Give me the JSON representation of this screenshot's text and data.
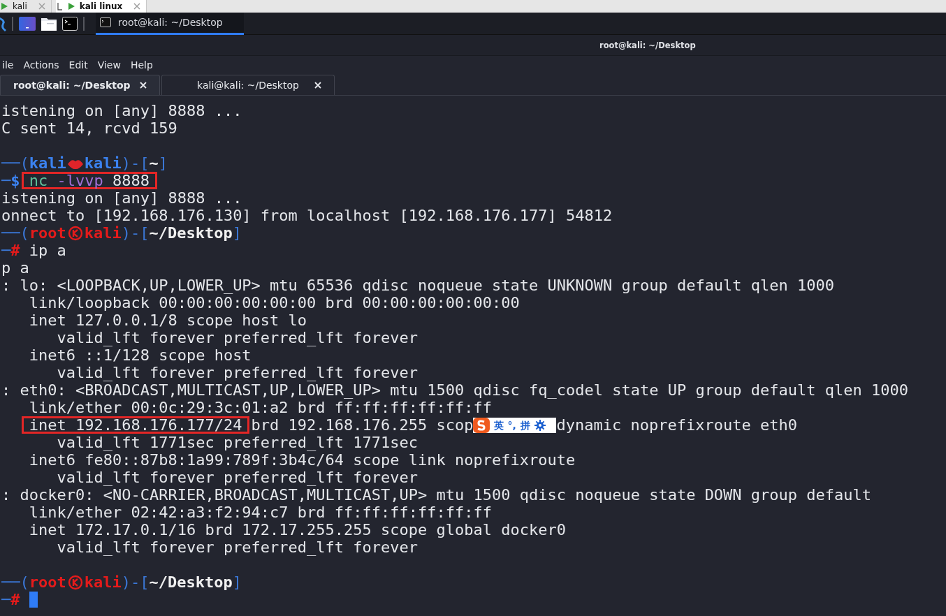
{
  "browser_tabs": [
    {
      "label": "kali",
      "selected": false
    },
    {
      "label": "kali linux",
      "selected": true
    }
  ],
  "panel": {
    "taskbar_items": [
      {
        "label": "root@kali: ~/Desktop",
        "selected": true
      }
    ]
  },
  "window": {
    "title": "root@kali: ~/Desktop",
    "menu": [
      "ile",
      "Actions",
      "Edit",
      "View",
      "Help"
    ],
    "tabs": [
      {
        "label": "root@kali: ~/Desktop",
        "selected": true
      },
      {
        "label": "kali@kali: ~/Desktop",
        "selected": false
      }
    ]
  },
  "terminal": {
    "lines": [
      {
        "kind": "text",
        "segments": [
          {
            "kind": "output",
            "text": "istening on [any] 8888 ..."
          }
        ]
      },
      {
        "kind": "text",
        "segments": [
          {
            "kind": "output",
            "text": "C sent 14, rcvd 159"
          }
        ]
      },
      {
        "kind": "blank"
      },
      {
        "kind": "text",
        "segments": [
          {
            "kind": "frame",
            "text": "──("
          },
          {
            "kind": "user",
            "text": "kali"
          },
          {
            "kind": "kiss-mark"
          },
          {
            "kind": "user",
            "text": "kali"
          },
          {
            "kind": "frame",
            "text": ")-["
          },
          {
            "kind": "path",
            "text": "~"
          },
          {
            "kind": "frame",
            "text": "]"
          }
        ]
      },
      {
        "kind": "text",
        "segments": [
          {
            "kind": "frame",
            "text": "─"
          },
          {
            "kind": "dollar",
            "text": "$ "
          },
          {
            "kind": "boxed",
            "segments": [
              {
                "kind": "command",
                "text": "nc"
              },
              {
                "kind": "option",
                "text": " -lvvp"
              },
              {
                "kind": "output",
                "text": " 8888"
              }
            ]
          }
        ]
      },
      {
        "kind": "text",
        "segments": [
          {
            "kind": "output",
            "text": "istening on [any] 8888 ..."
          }
        ]
      },
      {
        "kind": "text",
        "segments": [
          {
            "kind": "output",
            "text": "onnect to [192.168.176.130] from localhost [192.168.176.177] 54812"
          }
        ]
      },
      {
        "kind": "text",
        "segments": [
          {
            "kind": "frame",
            "text": "──("
          },
          {
            "kind": "root-user",
            "text": "root"
          },
          {
            "kind": "root-mark"
          },
          {
            "kind": "root-user",
            "text": "kali"
          },
          {
            "kind": "frame",
            "text": ")-["
          },
          {
            "kind": "path",
            "text": "~/Desktop"
          },
          {
            "kind": "frame",
            "text": "]"
          }
        ]
      },
      {
        "kind": "text",
        "segments": [
          {
            "kind": "frame",
            "text": "─"
          },
          {
            "kind": "hash",
            "text": "#"
          },
          {
            "kind": "output",
            "text": " ip a"
          }
        ]
      },
      {
        "kind": "text",
        "segments": [
          {
            "kind": "output",
            "text": "p a"
          }
        ]
      },
      {
        "kind": "text",
        "segments": [
          {
            "kind": "output",
            "text": ": lo: <LOOPBACK,UP,LOWER_UP> mtu 65536 qdisc noqueue state UNKNOWN group default qlen 1000"
          }
        ]
      },
      {
        "kind": "text",
        "segments": [
          {
            "kind": "output",
            "text": "   link/loopback 00:00:00:00:00:00 brd 00:00:00:00:00:00"
          }
        ]
      },
      {
        "kind": "text",
        "segments": [
          {
            "kind": "output",
            "text": "   inet 127.0.0.1/8 scope host lo"
          }
        ]
      },
      {
        "kind": "text",
        "segments": [
          {
            "kind": "output",
            "text": "      valid_lft forever preferred_lft forever"
          }
        ]
      },
      {
        "kind": "text",
        "segments": [
          {
            "kind": "output",
            "text": "   inet6 ::1/128 scope host"
          }
        ]
      },
      {
        "kind": "text",
        "segments": [
          {
            "kind": "output",
            "text": "      valid_lft forever preferred_lft forever"
          }
        ]
      },
      {
        "kind": "text",
        "segments": [
          {
            "kind": "output",
            "text": ": eth0: <BROADCAST,MULTICAST,UP,LOWER_UP> mtu 1500 qdisc fq_codel state UP group default qlen 1000"
          }
        ]
      },
      {
        "kind": "text",
        "segments": [
          {
            "kind": "output",
            "text": "   link/ether 00:0c:29:3c:01:a2 brd ff:ff:ff:ff:ff:ff"
          }
        ]
      },
      {
        "kind": "text",
        "segments": [
          {
            "kind": "boxed",
            "segments": [
              {
                "kind": "output",
                "text": "inet 192.168.176.177/24"
              }
            ]
          },
          {
            "kind": "output",
            "text": " brd 192.168.176.255 scop"
          },
          {
            "kind": "ime",
            "items": [
              "英",
              "°,",
              "拼"
            ]
          },
          {
            "kind": "output",
            "text": "dynamic noprefixroute eth0"
          }
        ]
      },
      {
        "kind": "text",
        "segments": [
          {
            "kind": "output",
            "text": "      valid_lft 1771sec preferred_lft 1771sec"
          }
        ]
      },
      {
        "kind": "text",
        "segments": [
          {
            "kind": "output",
            "text": "   inet6 fe80::87b8:1a99:789f:3b4c/64 scope link noprefixroute"
          }
        ]
      },
      {
        "kind": "text",
        "segments": [
          {
            "kind": "output",
            "text": "      valid_lft forever preferred_lft forever"
          }
        ]
      },
      {
        "kind": "text",
        "segments": [
          {
            "kind": "output",
            "text": ": docker0: <NO-CARRIER,BROADCAST,MULTICAST,UP> mtu 1500 qdisc noqueue state DOWN group default"
          }
        ]
      },
      {
        "kind": "text",
        "segments": [
          {
            "kind": "output",
            "text": "   link/ether 02:42:a3:f2:94:c7 brd ff:ff:ff:ff:ff:ff"
          }
        ]
      },
      {
        "kind": "text",
        "segments": [
          {
            "kind": "output",
            "text": "   inet 172.17.0.1/16 brd 172.17.255.255 scope global docker0"
          }
        ]
      },
      {
        "kind": "text",
        "segments": [
          {
            "kind": "output",
            "text": "      valid_lft forever preferred_lft forever"
          }
        ]
      },
      {
        "kind": "blank"
      },
      {
        "kind": "text",
        "segments": [
          {
            "kind": "frame",
            "text": "──("
          },
          {
            "kind": "root-user",
            "text": "root"
          },
          {
            "kind": "root-mark"
          },
          {
            "kind": "root-user",
            "text": "kali"
          },
          {
            "kind": "frame",
            "text": ")-["
          },
          {
            "kind": "path",
            "text": "~/Desktop"
          },
          {
            "kind": "frame",
            "text": "]"
          }
        ]
      },
      {
        "kind": "text",
        "segments": [
          {
            "kind": "frame",
            "text": "─"
          },
          {
            "kind": "hash",
            "text": "#"
          },
          {
            "kind": "cursor"
          }
        ]
      }
    ]
  }
}
